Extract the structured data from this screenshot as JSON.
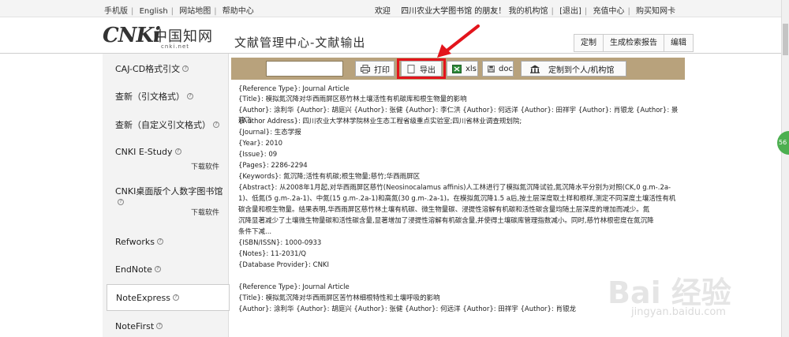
{
  "topbar": {
    "links": [
      "手机版",
      "English",
      "网站地图",
      "帮助中心"
    ],
    "welcome": "欢迎",
    "user": "四川农业大学图书馆 的朋友！",
    "my_org": "我的机构馆",
    "logout": "[退出]",
    "recharge": "充值中心",
    "buy_card": "购买知网卡"
  },
  "header": {
    "logo_cn": "CNKi",
    "logo_zh": "中国知网",
    "logo_net": "cnki.net",
    "title": "文献管理中心-文献输出",
    "buttons": [
      "定制",
      "生成检索报告",
      "编辑"
    ]
  },
  "sidebar": {
    "items": [
      {
        "label": "CAJ-CD格式引文",
        "download": ""
      },
      {
        "label": "查新（引文格式）",
        "download": ""
      },
      {
        "label": "查新（自定义引文格式）",
        "download": ""
      },
      {
        "label": "CNKI E-Study",
        "download": "下载软件"
      },
      {
        "label": "CNKI桌面版个人数字图书馆",
        "download": "下载软件"
      },
      {
        "label": "Refworks",
        "download": ""
      },
      {
        "label": "EndNote",
        "download": ""
      },
      {
        "label": "NoteExpress",
        "download": ""
      },
      {
        "label": "NoteFirst",
        "download": ""
      }
    ]
  },
  "toolbar": {
    "print": "打印",
    "export": "导出",
    "xls": "xls",
    "doc": "doc",
    "custom": "定制到个人/机构馆"
  },
  "content": {
    "lines": [
      "{Reference Type}: Journal Article",
      "{Title}: 模拟氮沉降对华西雨屏区慈竹林土壤活性有机碳库和根生物量的影响",
      "{Author}: 涂利华 {Author}: 胡庭兴 {Author}: 张健 {Author}: 李仁洪 {Author}: 何远洋 {Author}: 田祥宇 {Author}: 肖银龙 {Author}: 景建飞",
      "{Author Address}: 四川农业大学林学院林业生态工程省级重点实验室;四川省林业调查规划院;",
      "{Journal}: 生态学报",
      "{Year}: 2010",
      "{Issue}: 09",
      "{Pages}: 2286-2294",
      "{Keywords}: 氮沉降;活性有机碳;根生物量;慈竹;华西雨屏区",
      "{Abstract}: 从2008年1月起,对华西雨屏区慈竹(Neosinocalamus affinis)人工林进行了模拟氮沉降试验,氮沉降水平分别为对照(CK,0 g.m-.2a-",
      "1)、低氮(5 g.m-.2a-1)、中氮(15 g.m-.2a-1)和高氮(30 g.m-.2a-1)。在模拟氮沉降1.5 a后,按土层深度取土样和根样,测定不同深度土壤活性有机",
      "碳含量和根生物量。结果表明,华西雨屏区慈竹林土壤有机碳、微生物量碳、浸提性溶解有机碳和活性碳含量均随土层深度的增加而减少。氮",
      "沉降显著减少了土壤微生物量碳和活性碳含量,显著增加了浸提性溶解有机碳含量,并使得土壤碳库管理指数减小。同时,慈竹林根密度在氮沉降",
      "条件下减...",
      "{ISBN/ISSN}: 1000-0933",
      "{Notes}: 11-2031/Q",
      "{Database Provider}: CNKI",
      "",
      "{Reference Type}: Journal Article",
      "{Title}: 模拟氮沉降对华西雨屏区苦竹林细根特性和土壤呼吸的影响",
      "{Author}: 涂利华 {Author}: 胡庭兴 {Author}: 张健 {Author}: 何远洋 {Author}: 田祥宇 {Author}: 肖银龙"
    ]
  },
  "watermark": {
    "big": "Bai 经验",
    "small": "jingyan.baidu.com"
  },
  "float_badge": "56"
}
